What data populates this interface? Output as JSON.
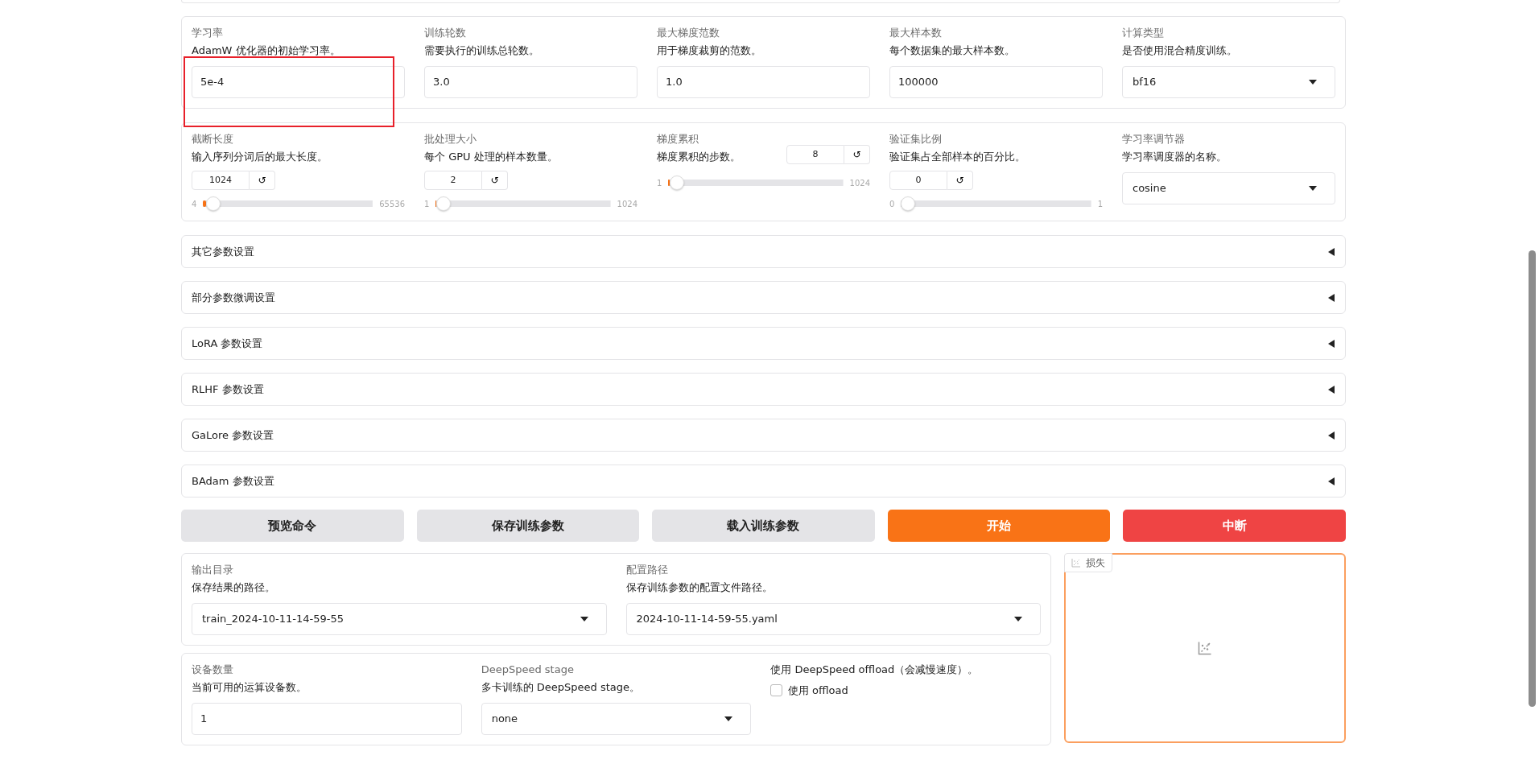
{
  "params_row_1": [
    {
      "kind": "text",
      "label": "学习率",
      "description": "AdamW 优化器的初始学习率。",
      "value": "5e-4",
      "highlighted": true
    },
    {
      "kind": "text",
      "label": "训练轮数",
      "description": "需要执行的训练总轮数。",
      "value": "3.0",
      "highlighted": false
    },
    {
      "kind": "text",
      "label": "最大梯度范数",
      "description": "用于梯度裁剪的范数。",
      "value": "1.0",
      "highlighted": false
    },
    {
      "kind": "text",
      "label": "最大样本数",
      "description": "每个数据集的最大样本数。",
      "value": "100000",
      "highlighted": false
    },
    {
      "kind": "select",
      "label": "计算类型",
      "description": "是否使用混合精度训练。",
      "value": "bf16",
      "highlighted": false
    }
  ],
  "params_row_2": [
    {
      "kind": "slider",
      "label": "截断长度",
      "description": "输入序列分词后的最大长度。",
      "value": "1024",
      "reset": "↺",
      "min": "4",
      "max": "65536",
      "level": 0.0156
    },
    {
      "kind": "slider",
      "label": "批处理大小",
      "description": "每个 GPU 处理的样本数量。",
      "value": "2",
      "reset": "↺",
      "min": "1",
      "max": "1024",
      "level": 0.001
    },
    {
      "kind": "slider_inline",
      "label": "梯度累积",
      "description": "梯度累积的步数。",
      "value": "8",
      "reset": "↺",
      "min": "1",
      "max": "1024",
      "level": 0.007
    },
    {
      "kind": "slider",
      "label": "验证集比例",
      "description": "验证集占全部样本的百分比。",
      "value": "0",
      "reset": "↺",
      "min": "0",
      "max": "1",
      "level": 0
    },
    {
      "kind": "select",
      "label": "学习率调节器",
      "description": "学习率调度器的名称。",
      "value": "cosine"
    }
  ],
  "accordions": [
    {
      "title": "其它参数设置",
      "expanded": false
    },
    {
      "title": "部分参数微调设置",
      "expanded": false
    },
    {
      "title": "LoRA 参数设置",
      "expanded": false
    },
    {
      "title": "RLHF 参数设置",
      "expanded": false
    },
    {
      "title": "GaLore 参数设置",
      "expanded": false
    },
    {
      "title": "BAdam 参数设置",
      "expanded": false
    }
  ],
  "actions": [
    {
      "label": "预览命令",
      "kind": "secondary"
    },
    {
      "label": "保存训练参数",
      "kind": "secondary"
    },
    {
      "label": "载入训练参数",
      "kind": "secondary"
    },
    {
      "label": "开始",
      "kind": "primary"
    },
    {
      "label": "中断",
      "kind": "stop"
    }
  ],
  "paths": [
    {
      "kind": "select",
      "label": "输出目录",
      "description": "保存结果的路径。",
      "value": "train_2024-10-11-14-59-55"
    },
    {
      "kind": "select",
      "label": "配置路径",
      "description": "保存训练参数的配置文件路径。",
      "value": "2024-10-11-14-59-55.yaml"
    }
  ],
  "devices": [
    {
      "kind": "text",
      "label": "设备数量",
      "description": "当前可用的运算设备数。",
      "value": "1"
    },
    {
      "kind": "select",
      "label": "DeepSpeed stage",
      "description": "多卡训练的 DeepSpeed stage。",
      "value": "none"
    },
    {
      "kind": "checkbox",
      "description": "使用 DeepSpeed offload（会减慢速度）。",
      "option": "使用 offload",
      "checked": false
    }
  ],
  "loss_plot": {
    "label": "损失"
  }
}
